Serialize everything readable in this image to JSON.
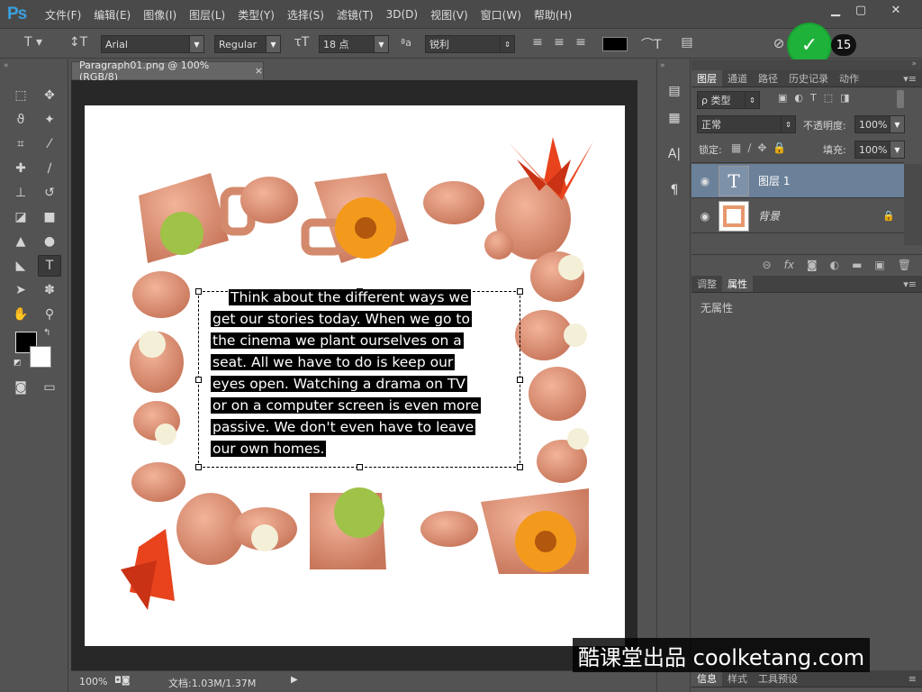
{
  "app": {
    "logo": "Ps"
  },
  "menu": [
    "文件(F)",
    "编辑(E)",
    "图像(I)",
    "图层(L)",
    "类型(Y)",
    "选择(S)",
    "滤镜(T)",
    "3D(D)",
    "视图(V)",
    "窗口(W)",
    "帮助(H)"
  ],
  "options": {
    "font_family": "Arial",
    "font_style": "Regular",
    "font_size": "18 点",
    "aa_label": "ªa",
    "antialias": "锐利",
    "text_color": "#000000",
    "commit_badge": "15"
  },
  "document": {
    "tab_title": "Paragraph01.png @ 100%(RGB/8)",
    "paragraph_lines": [
      "Think about the different ways we",
      "get our stories today. When we go to",
      "the cinema we plant ourselves on a",
      "seat. All we have to do is keep our",
      "eyes open. Watching a drama on TV",
      "or on a computer screen is even more",
      "passive. We don't even have to leave",
      "our own homes."
    ]
  },
  "status": {
    "zoom": "100%",
    "doc_size": "文档:1.03M/1.37M"
  },
  "layers_panel": {
    "tabs": [
      "图层",
      "通道",
      "路径",
      "历史记录",
      "动作"
    ],
    "filter_label": "ρ 类型",
    "blend_mode": "正常",
    "opacity_label": "不透明度:",
    "opacity_value": "100%",
    "lock_label": "锁定:",
    "fill_label": "填充:",
    "fill_value": "100%",
    "layers": [
      {
        "name": "图层 1",
        "type": "text",
        "selected": true
      },
      {
        "name": "背景",
        "type": "image",
        "locked": true
      }
    ]
  },
  "properties_panel": {
    "tabs": [
      "调整",
      "属性"
    ],
    "content": "无属性"
  },
  "bottom_tabs": [
    "信息",
    "样式",
    "工具预设"
  ],
  "watermark": "酷课堂出品 coolketang.com",
  "colors": {
    "accent_green": "#1fb23a",
    "layer_selected": "#6b8099"
  }
}
